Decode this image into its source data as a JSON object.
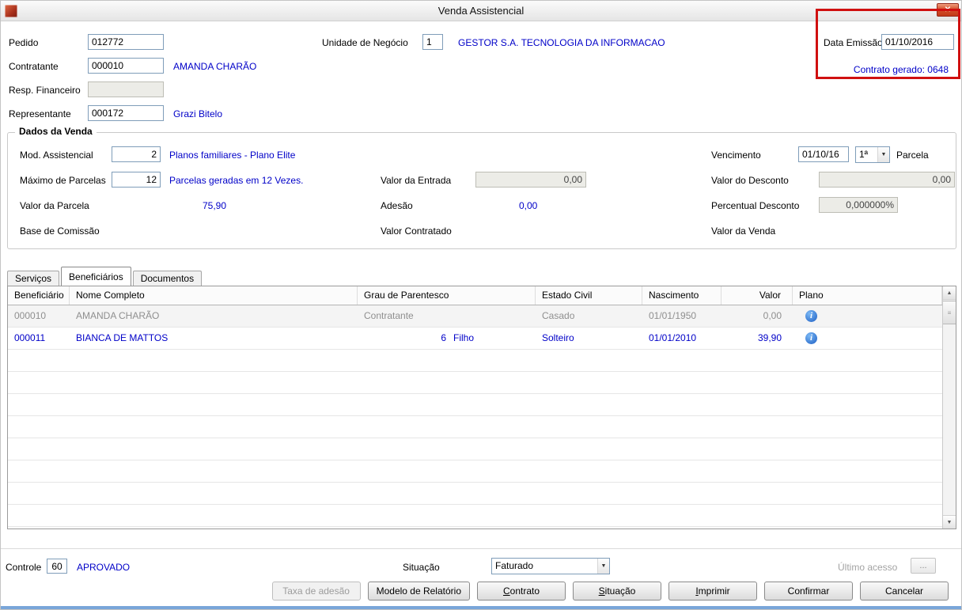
{
  "window": {
    "title": "Venda Assistencial"
  },
  "icons": {
    "close": "✕",
    "dropdown": "▼",
    "scroll_up": "▲",
    "scroll_down": "▼",
    "grip": "≡",
    "info": "i"
  },
  "header": {
    "pedido": {
      "label": "Pedido",
      "value": "012772"
    },
    "unidade_negocio": {
      "label": "Unidade de Negócio",
      "code": "1",
      "name": "GESTOR S.A. TECNOLOGIA DA INFORMACAO"
    },
    "data_emissao": {
      "label": "Data Emissão",
      "value": "01/10/2016"
    },
    "contratante": {
      "label": "Contratante",
      "code": "000010",
      "name": "AMANDA CHARÃO"
    },
    "contrato_gerado": "Contrato gerado: 0648",
    "resp_financeiro": {
      "label": "Resp. Financeiro",
      "value": ""
    },
    "representante": {
      "label": "Representante",
      "code": "000172",
      "name": "Grazi Bitelo"
    }
  },
  "dados_venda": {
    "legend": "Dados da Venda",
    "mod_assistencial": {
      "label": "Mod. Assistencial",
      "value": "2",
      "desc": "Planos familiares - Plano Elite"
    },
    "vencimento": {
      "label": "Vencimento",
      "date": "01/10/16",
      "parcela_value": "1ª",
      "parcela_label": "Parcela"
    },
    "maximo_parcelas": {
      "label": "Máximo de Parcelas",
      "value": "12",
      "desc": "Parcelas geradas em 12 Vezes."
    },
    "valor_entrada": {
      "label": "Valor da Entrada",
      "value": "0,00"
    },
    "valor_desconto": {
      "label": "Valor do Desconto",
      "value": "0,00"
    },
    "valor_parcela": {
      "label": "Valor da Parcela",
      "value": "75,90"
    },
    "adesao": {
      "label": "Adesão",
      "value": "0,00"
    },
    "percentual_desconto": {
      "label": "Percentual Desconto",
      "value": "0,000000%"
    },
    "base_comissao": {
      "label": "Base de Comissão"
    },
    "valor_contratado": {
      "label": "Valor Contratado"
    },
    "valor_venda": {
      "label": "Valor da Venda"
    }
  },
  "tabs": [
    {
      "label": "Serviços",
      "name": "tab-servicos",
      "active": false
    },
    {
      "label": "Beneficiários",
      "name": "tab-beneficiarios",
      "active": true
    },
    {
      "label": "Documentos",
      "name": "tab-documentos",
      "active": false
    }
  ],
  "table": {
    "columns": [
      "Beneficiário",
      "Nome Completo",
      "Grau de Parentesco",
      "Estado Civil",
      "Nascimento",
      "Valor",
      "Plano"
    ],
    "rows": [
      {
        "beneficiario": "000010",
        "nome": "AMANDA CHARÃO",
        "parentesco_code": "",
        "parentesco": "Contratante",
        "estado_civil": "Casado",
        "nascimento": "01/01/1950",
        "valor": "0,00",
        "state": "readonly"
      },
      {
        "beneficiario": "000011",
        "nome": "BIANCA DE MATTOS",
        "parentesco_code": "6",
        "parentesco": "Filho",
        "estado_civil": "Solteiro",
        "nascimento": "01/01/2010",
        "valor": "39,90",
        "state": "selected"
      }
    ],
    "empty_rows": 8
  },
  "footer": {
    "controle": {
      "label": "Controle",
      "value": "60",
      "status": "APROVADO"
    },
    "situacao": {
      "label": "Situação",
      "value": "Faturado"
    },
    "ultimo_acesso": {
      "label": "Último acesso",
      "button": "..."
    },
    "buttons": [
      {
        "label": "Taxa de adesão",
        "name": "taxa-de-adesao-button",
        "disabled": true,
        "underline_first": false
      },
      {
        "label": "Modelo de Relatório",
        "name": "modelo-de-relatorio-button",
        "disabled": false,
        "underline_first": false
      },
      {
        "label": "Contrato",
        "name": "contrato-button",
        "disabled": false,
        "underline_first": true
      },
      {
        "label": "Situação",
        "name": "situacao-button",
        "disabled": false,
        "underline_first": true
      },
      {
        "label": "Imprimir",
        "name": "imprimir-button",
        "disabled": false,
        "underline_first": true
      },
      {
        "label": "Confirmar",
        "name": "confirmar-button",
        "disabled": false,
        "underline_first": false
      },
      {
        "label": "Cancelar",
        "name": "cancelar-button",
        "disabled": false,
        "underline_first": false
      }
    ]
  },
  "annotation": {
    "color": "#d01010"
  }
}
